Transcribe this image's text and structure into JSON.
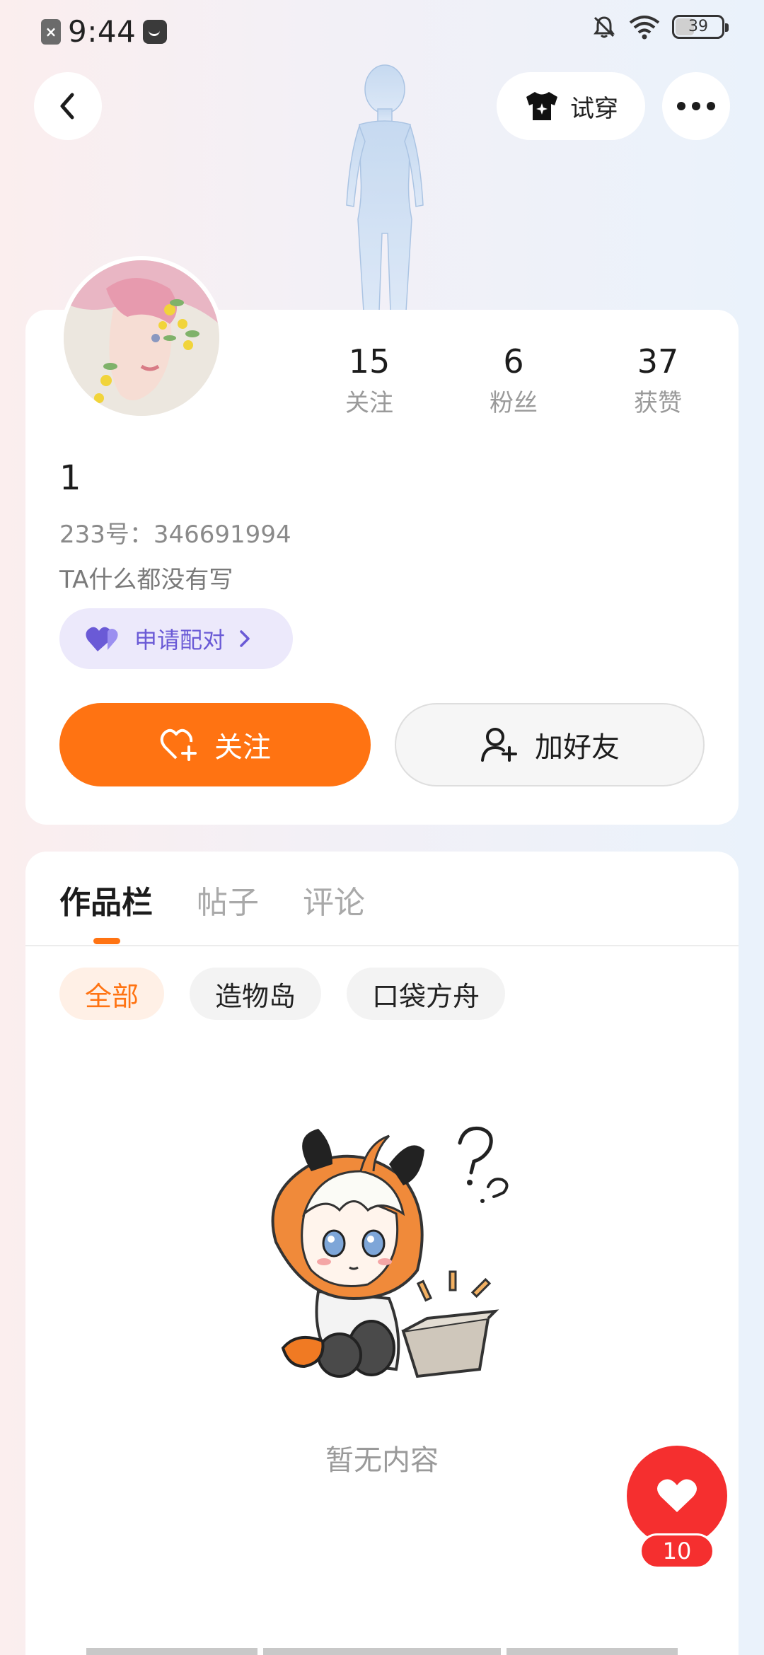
{
  "status_bar": {
    "time": "9:44",
    "battery": "39",
    "icons": [
      "app-close-icon",
      "message-icon",
      "mute-bell-icon",
      "wifi-icon",
      "battery-icon"
    ]
  },
  "nav": {
    "tryon_label": "试穿",
    "icons": [
      "back-arrow-icon",
      "tshirt-icon",
      "more-dots-icon"
    ]
  },
  "profile": {
    "stats": [
      {
        "num": "15",
        "label": "关注"
      },
      {
        "num": "6",
        "label": "粉丝"
      },
      {
        "num": "37",
        "label": "获赞"
      }
    ],
    "username": "1",
    "uid": "233号：346691994",
    "bio": "TA什么都没有写",
    "pair_label": "申请配对",
    "follow_label": "关注",
    "add_friend_label": "加好友"
  },
  "works": {
    "tabs": [
      {
        "label": "作品栏",
        "active": true
      },
      {
        "label": "帖子",
        "active": false
      },
      {
        "label": "评论",
        "active": false
      }
    ],
    "chips": [
      {
        "label": "全部",
        "active": true
      },
      {
        "label": "造物岛",
        "active": false
      },
      {
        "label": "口袋方舟",
        "active": false
      }
    ],
    "empty_text": "暂无内容"
  },
  "like": {
    "count": "10"
  },
  "colors": {
    "accent": "#ff7312",
    "pair": "#6a5ad6",
    "like": "#f52f2f"
  }
}
